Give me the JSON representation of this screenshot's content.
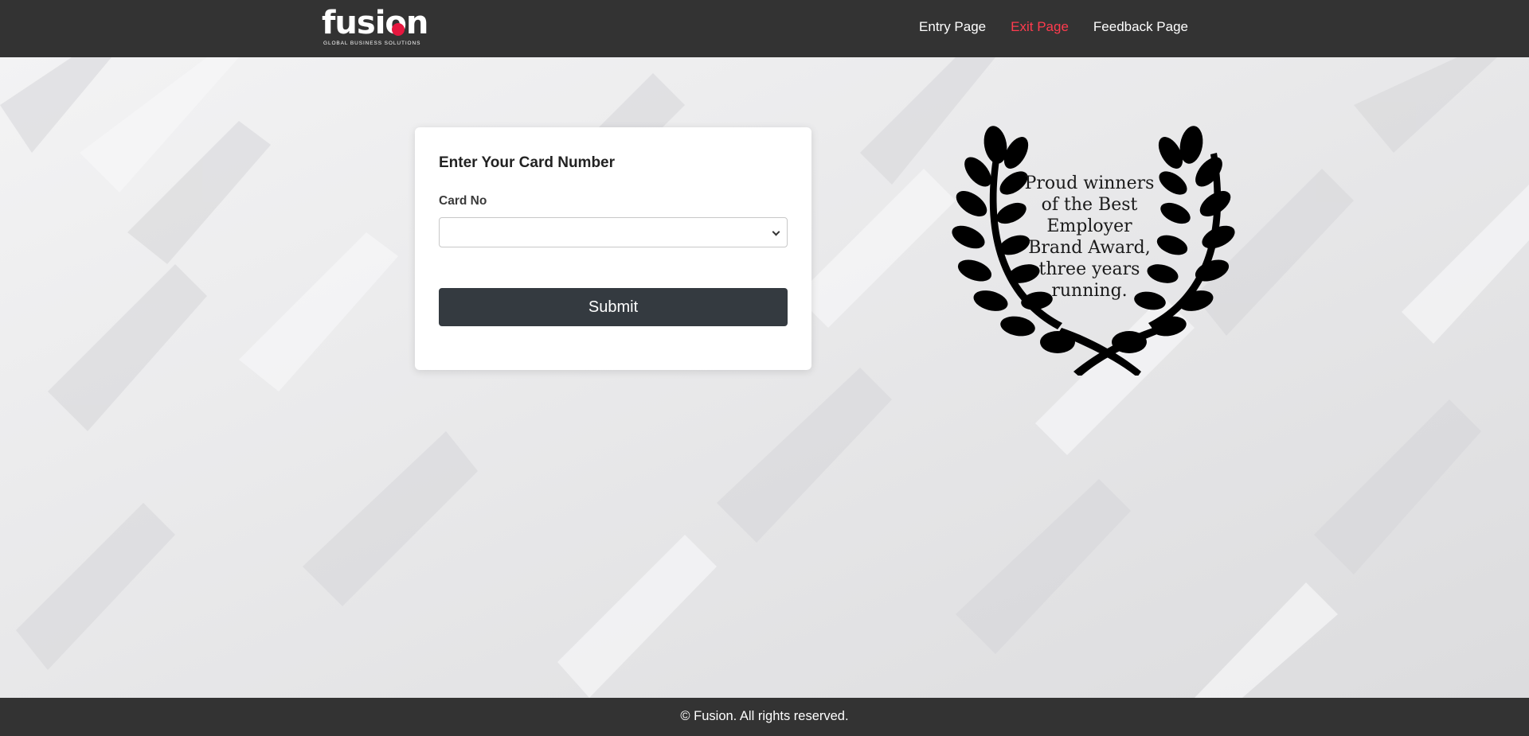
{
  "header": {
    "logo": {
      "word": "fusion",
      "tagline": "GLOBAL BUSINESS SOLUTIONS"
    },
    "nav": [
      {
        "label": "Entry Page",
        "active": false
      },
      {
        "label": "Exit Page",
        "active": true
      },
      {
        "label": "Feedback Page",
        "active": false
      }
    ]
  },
  "form": {
    "title": "Enter Your Card Number",
    "card_no_label": "Card No",
    "card_no_value": "",
    "submit_label": "Submit"
  },
  "award": {
    "lines": [
      "Proud winners",
      "of the Best",
      "Employer",
      "Brand Award,",
      "three years",
      "running."
    ]
  },
  "footer": {
    "text": "© Fusion. All rights reserved."
  },
  "colors": {
    "nav_bg": "#333333",
    "active_link": "#ff3b4e",
    "button_bg": "#343a40",
    "logo_dot": "#e5173f"
  }
}
